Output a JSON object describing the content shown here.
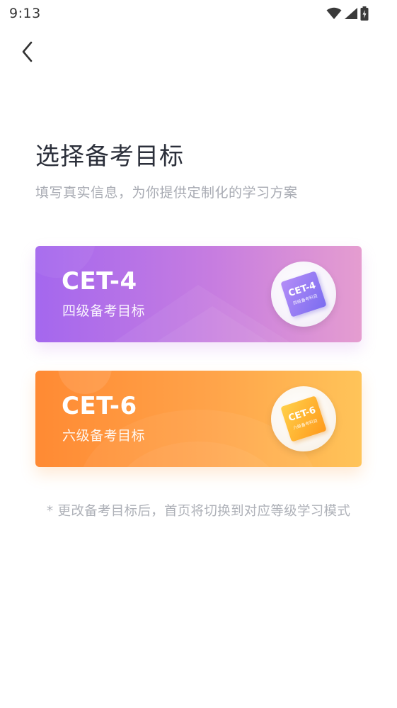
{
  "status_bar": {
    "time": "9:13"
  },
  "header": {
    "title": "选择备考目标",
    "subtitle": "填写真实信息，为你提供定制化的学习方案"
  },
  "targets": [
    {
      "title": "CET-4",
      "subtitle": "四级备考目标",
      "badge_title": "CET-4",
      "badge_subtitle": "四级备考科目",
      "gradient": [
        "#a467ee",
        "#e59dd0"
      ]
    },
    {
      "title": "CET-6",
      "subtitle": "六级备考目标",
      "badge_title": "CET-6",
      "badge_subtitle": "六级备考科目",
      "gradient": [
        "#ff8a33",
        "#ffc459"
      ]
    }
  ],
  "footnote": "* 更改备考目标后，首页将切换到对应等级学习模式",
  "icons": {
    "back": "chevron-left-icon",
    "wifi": "wifi-icon",
    "signal": "signal-icon",
    "battery": "battery-charging-icon"
  }
}
